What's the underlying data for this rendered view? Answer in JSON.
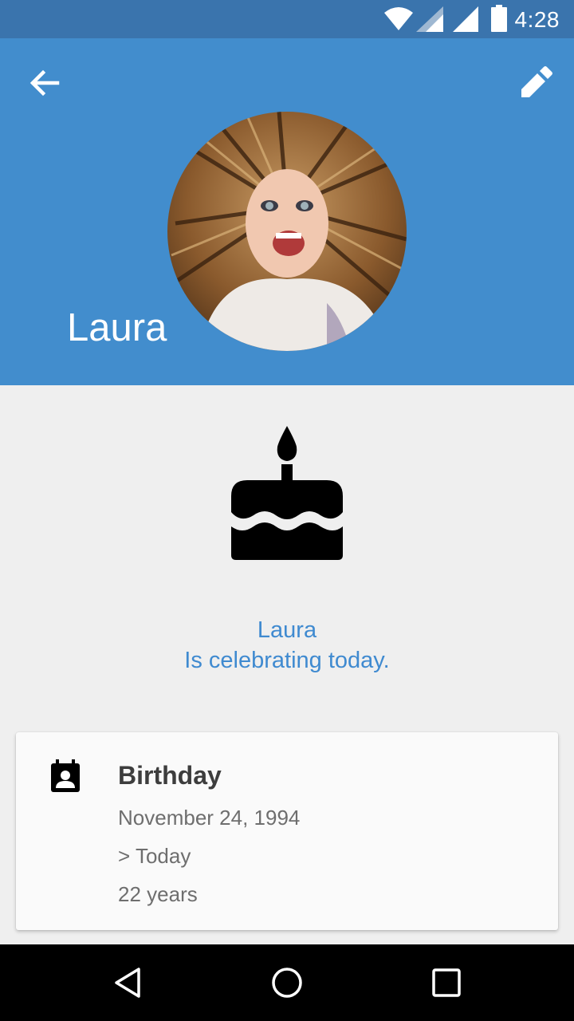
{
  "status_bar": {
    "time": "4:28",
    "icons": [
      "wifi-icon",
      "cell-signal-icon",
      "cell-signal-icon",
      "battery-icon"
    ]
  },
  "header": {
    "name": "Laura",
    "back_icon": "arrow-back-icon",
    "edit_icon": "pencil-icon",
    "avatar": "contact-photo",
    "color": "#428dcd"
  },
  "celebration": {
    "icon": "cake-icon",
    "line1": "Laura",
    "line2": "Is celebrating today.",
    "text_color": "#3f8ad0"
  },
  "event_card": {
    "icon": "calendar-contact-icon",
    "title": "Birthday",
    "date": "November 24, 1994",
    "when": "> Today",
    "age": "22 years"
  },
  "nav_bar": {
    "buttons": [
      "back-triangle-icon",
      "home-circle-icon",
      "recents-square-icon"
    ]
  }
}
